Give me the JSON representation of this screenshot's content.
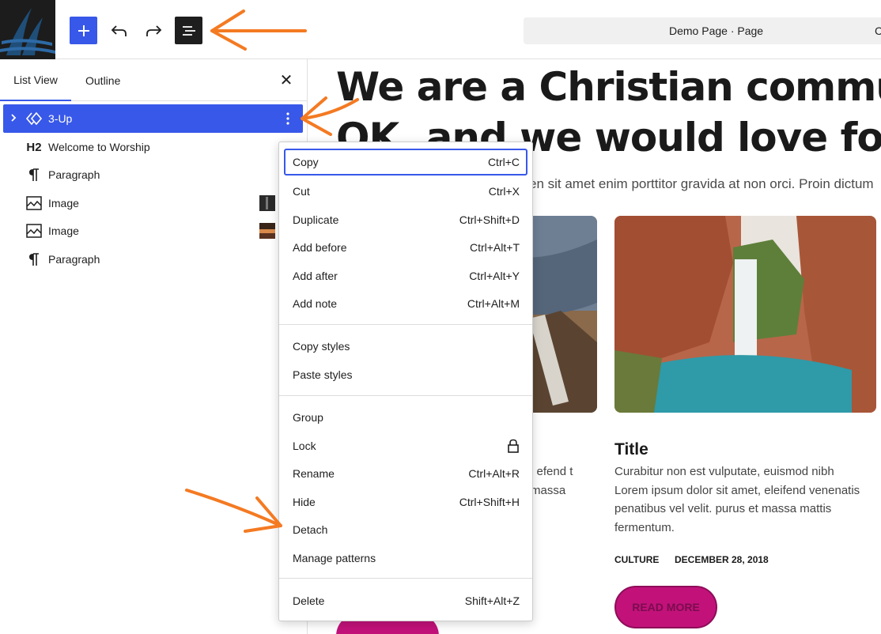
{
  "toolbar": {
    "add_icon": "plus-icon",
    "undo_icon": "undo-icon",
    "redo_icon": "redo-icon",
    "list_view_icon": "list-view-icon",
    "document_title": "Demo Page · Page",
    "shortcut_hint": "C"
  },
  "sidebar": {
    "tabs": [
      "List View",
      "Outline"
    ],
    "close_icon": "close-icon",
    "close_glyph": "✕",
    "items": [
      {
        "label": "3-Up",
        "icon": "pattern-icon",
        "selected": true
      },
      {
        "label": "Welcome to Worship",
        "prefix": "H2",
        "icon": "heading-icon"
      },
      {
        "label": "Paragraph",
        "icon": "paragraph-icon"
      },
      {
        "label": "Image",
        "icon": "image-icon"
      },
      {
        "label": "Image",
        "icon": "image-icon"
      },
      {
        "label": "Paragraph",
        "icon": "paragraph-icon"
      }
    ]
  },
  "canvas": {
    "hero_line1": "We are a Christian community",
    "hero_line2": "OK, and we would love for you",
    "hero_sub": "en sit amet enim porttitor gravida at non orci. Proin dictum",
    "card_title": "Title",
    "card_text": "Curabitur non est vulputate, euismod nibh Lorem ipsum dolor sit amet, eleifend venenatis penatibus vel velit. purus et massa mattis fermentum.",
    "card_text_left": "l efend t massa",
    "category": "CULTURE",
    "date": "DECEMBER 28, 2018",
    "read_more": "READ MORE"
  },
  "menu": {
    "groups": [
      [
        {
          "label": "Copy",
          "shortcut": "Ctrl+C",
          "focused": true
        },
        {
          "label": "Cut",
          "shortcut": "Ctrl+X"
        },
        {
          "label": "Duplicate",
          "shortcut": "Ctrl+Shift+D"
        },
        {
          "label": "Add before",
          "shortcut": "Ctrl+Alt+T"
        },
        {
          "label": "Add after",
          "shortcut": "Ctrl+Alt+Y"
        },
        {
          "label": "Add note",
          "shortcut": "Ctrl+Alt+M"
        }
      ],
      [
        {
          "label": "Copy styles",
          "shortcut": ""
        },
        {
          "label": "Paste styles",
          "shortcut": ""
        }
      ],
      [
        {
          "label": "Group",
          "shortcut": ""
        },
        {
          "label": "Lock",
          "shortcut": "",
          "icon": "lock-icon"
        },
        {
          "label": "Rename",
          "shortcut": "Ctrl+Alt+R"
        },
        {
          "label": "Hide",
          "shortcut": "Ctrl+Shift+H"
        },
        {
          "label": "Detach",
          "shortcut": ""
        },
        {
          "label": "Manage patterns",
          "shortcut": ""
        }
      ],
      [
        {
          "label": "Delete",
          "shortcut": "Shift+Alt+Z"
        }
      ]
    ]
  },
  "colors": {
    "accent": "#3858e9",
    "annotation": "#f47a22",
    "button": "#c2127a"
  }
}
